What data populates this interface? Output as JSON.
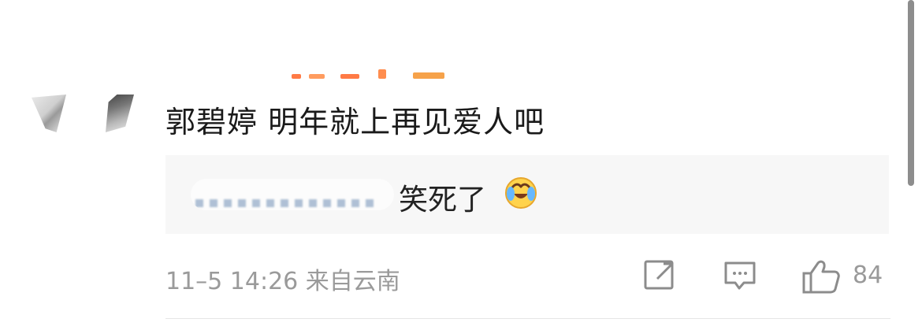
{
  "comment": {
    "text": "郭碧婷 明年就上再见爱人吧"
  },
  "reply": {
    "text": "笑死了",
    "emoji": "laughing-crying-emoji"
  },
  "meta": {
    "time_location": "11–5 14:26 来自云南"
  },
  "actions": {
    "share_icon": "share-icon",
    "comment_icon": "comment-icon",
    "like_icon": "like-icon",
    "like_count": "84"
  },
  "colors": {
    "text_primary": "#1a1a1a",
    "text_secondary": "#9a9a9a",
    "reply_bg": "#f7f7f7",
    "link_blue": "#6f8fb4"
  }
}
